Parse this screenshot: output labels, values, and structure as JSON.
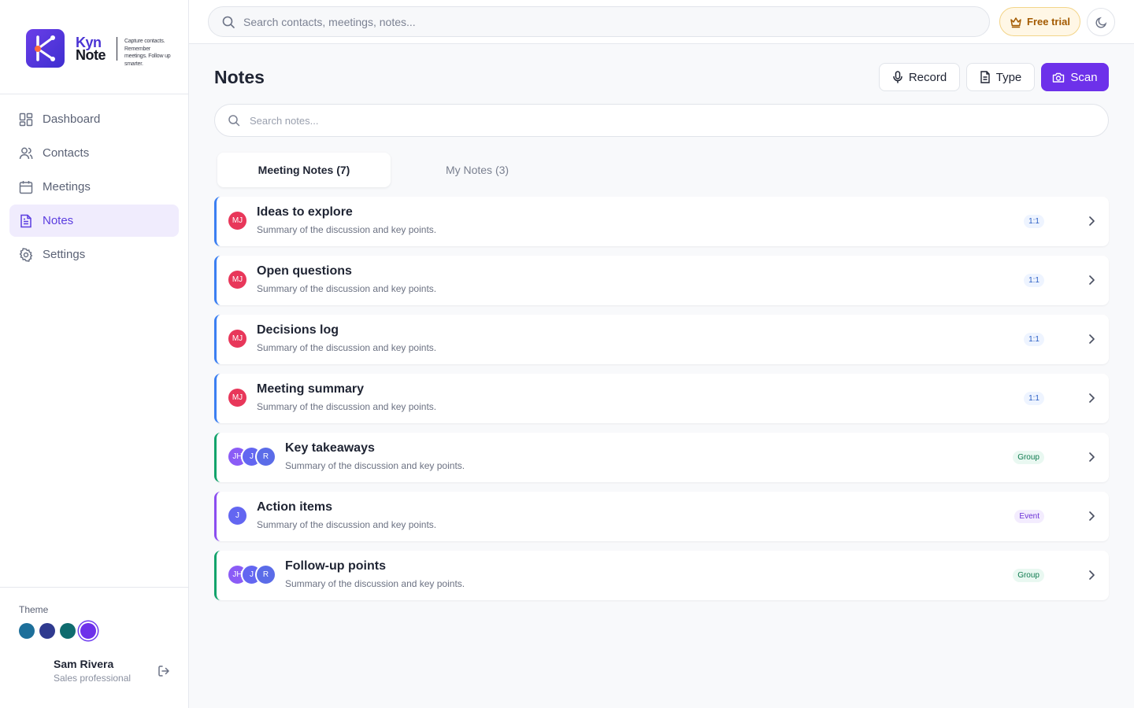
{
  "brand": {
    "word1": "Kyn",
    "word2": "Note",
    "tagline": "Capture contacts. Remember meetings. Follow up smarter."
  },
  "sidebar": {
    "items": [
      {
        "label": "Dashboard",
        "icon": "dashboard-icon"
      },
      {
        "label": "Contacts",
        "icon": "users-icon"
      },
      {
        "label": "Meetings",
        "icon": "calendar-icon"
      },
      {
        "label": "Notes",
        "icon": "document-icon",
        "active": true
      },
      {
        "label": "Settings",
        "icon": "gear-icon"
      }
    ],
    "theme_label": "Theme",
    "theme_swatches": [
      "#1d6f9a",
      "#2f3a8f",
      "#0f6b6e",
      "#6d31ea"
    ],
    "user": {
      "name": "Sam Rivera",
      "role": "Sales professional"
    }
  },
  "topbar": {
    "search_placeholder": "Search contacts, meetings, notes...",
    "trial_label": "Free trial"
  },
  "main": {
    "title": "Notes",
    "buttons": {
      "record": "Record",
      "type": "Type",
      "scan": "Scan"
    },
    "search_placeholder": "Search notes...",
    "tabs": [
      {
        "label": "Meeting Notes (7)",
        "active": true
      },
      {
        "label": "My Notes (3)",
        "active": false
      }
    ],
    "notes": [
      {
        "title": "Ideas to explore",
        "summary": "Summary of the discussion and key points.",
        "tag": "1:1",
        "avatars": [
          "MJ"
        ]
      },
      {
        "title": "Open questions",
        "summary": "Summary of the discussion and key points.",
        "tag": "1:1",
        "avatars": [
          "MJ"
        ]
      },
      {
        "title": "Decisions log",
        "summary": "Summary of the discussion and key points.",
        "tag": "1:1",
        "avatars": [
          "MJ"
        ]
      },
      {
        "title": "Meeting summary",
        "summary": "Summary of the discussion and key points.",
        "tag": "1:1",
        "avatars": [
          "MJ"
        ]
      },
      {
        "title": "Key takeaways",
        "summary": "Summary of the discussion and key points.",
        "tag": "Group",
        "avatars": [
          "JH",
          "J",
          "R"
        ]
      },
      {
        "title": "Action items",
        "summary": "Summary of the discussion and key points.",
        "tag": "Event",
        "avatars": [
          "J"
        ]
      },
      {
        "title": "Follow-up points",
        "summary": "Summary of the discussion and key points.",
        "tag": "Group",
        "avatars": [
          "JH",
          "J",
          "R"
        ]
      }
    ]
  },
  "colors": {
    "accent": "#6d31ea",
    "tag_one_on_one": "#3b7ff2",
    "tag_group": "#12a36b",
    "tag_event": "#8b4ef0",
    "avatar_mj": "#e8375a",
    "avatar_jh": "#8b5cf6",
    "avatar_j": "#6366f1",
    "avatar_r": "#5b6ce8"
  }
}
